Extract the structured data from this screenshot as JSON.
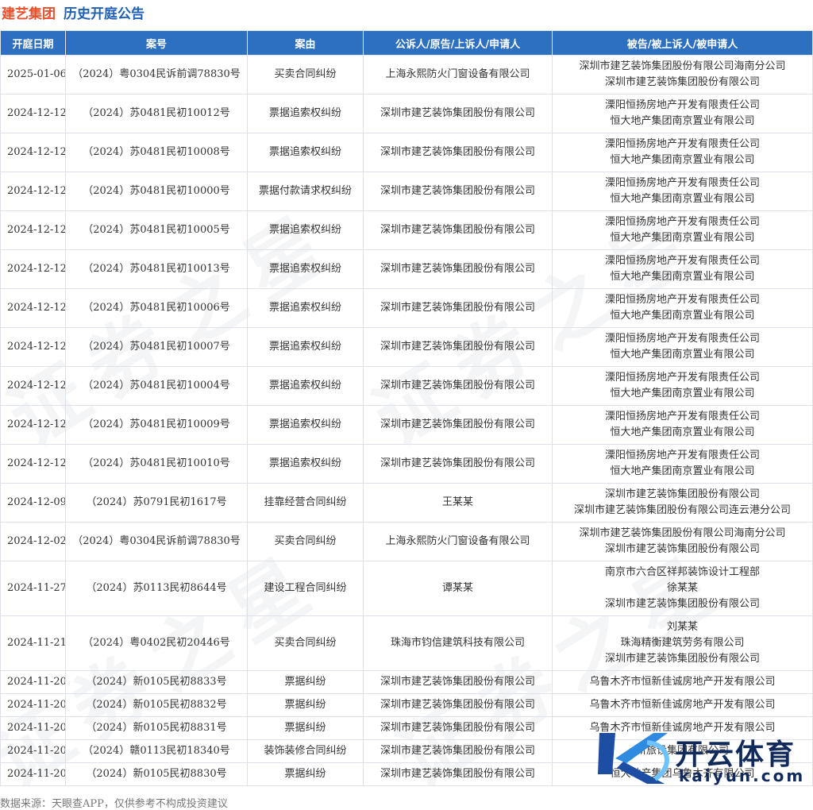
{
  "header": {
    "company": "建艺集团",
    "title": "历史开庭公告"
  },
  "table": {
    "columns": [
      "开庭日期",
      "案号",
      "案由",
      "公诉人/原告/上诉人/申请人",
      "被告/被上诉人/被申请人"
    ],
    "rows": [
      {
        "date": "2025-01-06",
        "case_no": "（2024）粤0304民诉前调78830号",
        "cause": "买卖合同纠纷",
        "plaintiff": "上海永熙防火门窗设备有限公司",
        "defendants": [
          "深圳市建艺装饰集团股份有限公司海南分公司",
          "深圳市建艺装饰集团股份有限公司"
        ]
      },
      {
        "date": "2024-12-12",
        "case_no": "（2024）苏0481民初10012号",
        "cause": "票据追索权纠纷",
        "plaintiff": "深圳市建艺装饰集团股份有限公司",
        "defendants": [
          "溧阳恒扬房地产开发有限责任公司",
          "恒大地产集团南京置业有限公司"
        ]
      },
      {
        "date": "2024-12-12",
        "case_no": "（2024）苏0481民初10008号",
        "cause": "票据追索权纠纷",
        "plaintiff": "深圳市建艺装饰集团股份有限公司",
        "defendants": [
          "溧阳恒扬房地产开发有限责任公司",
          "恒大地产集团南京置业有限公司"
        ]
      },
      {
        "date": "2024-12-12",
        "case_no": "（2024）苏0481民初10000号",
        "cause": "票据付款请求权纠纷",
        "plaintiff": "深圳市建艺装饰集团股份有限公司",
        "defendants": [
          "溧阳恒扬房地产开发有限责任公司",
          "恒大地产集团南京置业有限公司"
        ]
      },
      {
        "date": "2024-12-12",
        "case_no": "（2024）苏0481民初10005号",
        "cause": "票据追索权纠纷",
        "plaintiff": "深圳市建艺装饰集团股份有限公司",
        "defendants": [
          "溧阳恒扬房地产开发有限责任公司",
          "恒大地产集团南京置业有限公司"
        ]
      },
      {
        "date": "2024-12-12",
        "case_no": "（2024）苏0481民初10013号",
        "cause": "票据追索权纠纷",
        "plaintiff": "深圳市建艺装饰集团股份有限公司",
        "defendants": [
          "溧阳恒扬房地产开发有限责任公司",
          "恒大地产集团南京置业有限公司"
        ]
      },
      {
        "date": "2024-12-12",
        "case_no": "（2024）苏0481民初10006号",
        "cause": "票据追索权纠纷",
        "plaintiff": "深圳市建艺装饰集团股份有限公司",
        "defendants": [
          "溧阳恒扬房地产开发有限责任公司",
          "恒大地产集团南京置业有限公司"
        ]
      },
      {
        "date": "2024-12-12",
        "case_no": "（2024）苏0481民初10007号",
        "cause": "票据追索权纠纷",
        "plaintiff": "深圳市建艺装饰集团股份有限公司",
        "defendants": [
          "溧阳恒扬房地产开发有限责任公司",
          "恒大地产集团南京置业有限公司"
        ]
      },
      {
        "date": "2024-12-12",
        "case_no": "（2024）苏0481民初10004号",
        "cause": "票据追索权纠纷",
        "plaintiff": "深圳市建艺装饰集团股份有限公司",
        "defendants": [
          "溧阳恒扬房地产开发有限责任公司",
          "恒大地产集团南京置业有限公司"
        ]
      },
      {
        "date": "2024-12-12",
        "case_no": "（2024）苏0481民初10009号",
        "cause": "票据追索权纠纷",
        "plaintiff": "深圳市建艺装饰集团股份有限公司",
        "defendants": [
          "溧阳恒扬房地产开发有限责任公司",
          "恒大地产集团南京置业有限公司"
        ]
      },
      {
        "date": "2024-12-12",
        "case_no": "（2024）苏0481民初10010号",
        "cause": "票据追索权纠纷",
        "plaintiff": "深圳市建艺装饰集团股份有限公司",
        "defendants": [
          "溧阳恒扬房地产开发有限责任公司",
          "恒大地产集团南京置业有限公司"
        ]
      },
      {
        "date": "2024-12-09",
        "case_no": "（2024）苏0791民初1617号",
        "cause": "挂靠经营合同纠纷",
        "plaintiff": "王某某",
        "defendants": [
          "深圳市建艺装饰集团股份有限公司",
          "深圳市建艺装饰集团股份有限公司连云港分公司"
        ]
      },
      {
        "date": "2024-12-02",
        "case_no": "（2024）粤0304民诉前调78830号",
        "cause": "买卖合同纠纷",
        "plaintiff": "上海永熙防火门窗设备有限公司",
        "defendants": [
          "深圳市建艺装饰集团股份有限公司海南分公司",
          "深圳市建艺装饰集团股份有限公司"
        ]
      },
      {
        "date": "2024-11-27",
        "case_no": "（2024）苏0113民初8644号",
        "cause": "建设工程合同纠纷",
        "plaintiff": "谭某某",
        "defendants": [
          "南京市六合区祥邦装饰设计工程部",
          "徐某某",
          "深圳市建艺装饰集团股份有限公司"
        ]
      },
      {
        "date": "2024-11-21",
        "case_no": "（2024）粤0402民初20446号",
        "cause": "买卖合同纠纷",
        "plaintiff": "珠海市钧信建筑科技有限公司",
        "defendants": [
          "刘某某",
          "珠海精衡建筑劳务有限公司",
          "深圳市建艺装饰集团股份有限公司"
        ]
      },
      {
        "date": "2024-11-20",
        "case_no": "（2024）新0105民初8833号",
        "cause": "票据纠纷",
        "plaintiff": "深圳市建艺装饰集团股份有限公司",
        "defendants": [
          "乌鲁木齐市恒新佳诚房地产开发有限公司"
        ]
      },
      {
        "date": "2024-11-20",
        "case_no": "（2024）新0105民初8832号",
        "cause": "票据纠纷",
        "plaintiff": "深圳市建艺装饰集团股份有限公司",
        "defendants": [
          "乌鲁木齐市恒新佳诚房地产开发有限公司"
        ]
      },
      {
        "date": "2024-11-20",
        "case_no": "（2024）新0105民初8831号",
        "cause": "票据纠纷",
        "plaintiff": "深圳市建艺装饰集团股份有限公司",
        "defendants": [
          "乌鲁木齐市恒新佳诚房地产开发有限公司"
        ]
      },
      {
        "date": "2024-11-20",
        "case_no": "（2024）赣0113民初18340号",
        "cause": "装饰装修合同纠纷",
        "plaintiff": "深圳市建艺装饰集团股份有限公司",
        "defendants": [
          "新旅设集团有限公司"
        ]
      },
      {
        "date": "2024-11-20",
        "case_no": "（2024）新0105民初8830号",
        "cause": "票据纠纷",
        "plaintiff": "深圳市建艺装饰集团股份有限公司",
        "defendants": [
          "恒大地产集团乌鲁木齐有限公司"
        ]
      }
    ]
  },
  "footer": {
    "source": "数据来源：天眼查APP，仅供参考不构成投资建议"
  },
  "watermark": {
    "text": "证券之星"
  },
  "logo": {
    "cn": "开云体育",
    "en": "kaiyun.com"
  },
  "colors": {
    "header_bg": "#2d6fc0",
    "company_title": "#e8502a",
    "page_title": "#1f5fb5"
  }
}
